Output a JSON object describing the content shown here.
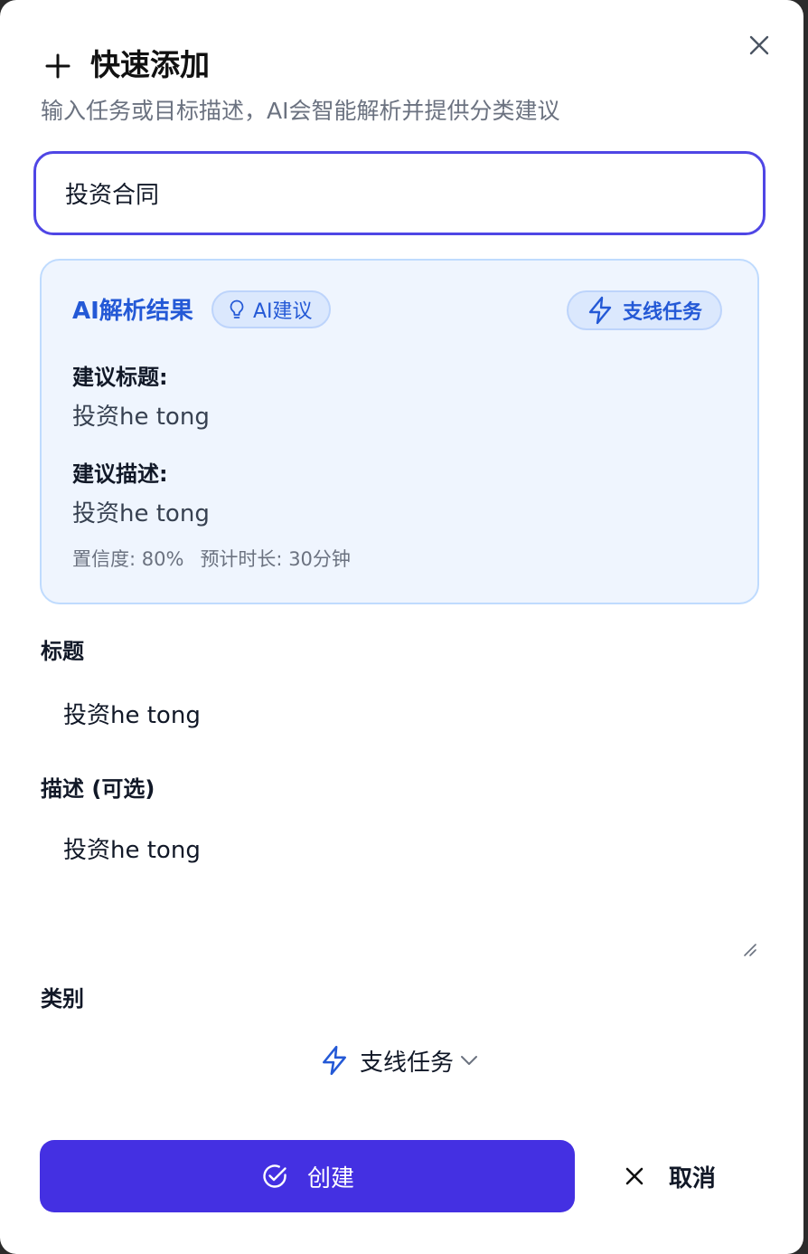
{
  "dialog": {
    "title": "快速添加",
    "subtitle": "输入任务或目标描述，AI会智能解析并提供分类建议",
    "input_value": "投资合同"
  },
  "ai_result": {
    "heading": "AI解析结果",
    "ai_badge": "AI建议",
    "category_badge": "支线任务",
    "suggested_title_label": "建议标题:",
    "suggested_title_value": "投资he tong",
    "suggested_desc_label": "建议描述:",
    "suggested_desc_value": "投资he tong",
    "confidence": "置信度: 80%",
    "duration": "预计时长: 30分钟"
  },
  "form": {
    "title_label": "标题",
    "title_value": "投资he tong",
    "desc_label": "描述 (可选)",
    "desc_value": "投资he tong",
    "category_label": "类别",
    "category_value": "支线任务"
  },
  "actions": {
    "create_label": "创建",
    "cancel_label": "取消"
  },
  "icons": {
    "add": "plus-icon",
    "close": "close-icon",
    "ai_badge": "lightbulb-icon",
    "category": "lightning-icon",
    "select_caret": "chevron-down-icon",
    "create": "check-circle-icon",
    "cancel": "x-icon"
  },
  "colors": {
    "accent": "#4430e2",
    "input_border": "#4f46e5",
    "card_bg": "#eff5fe",
    "card_border": "#bfdbfe",
    "ai_blue": "#2459d6",
    "badge_bg": "#dbe8fd"
  }
}
